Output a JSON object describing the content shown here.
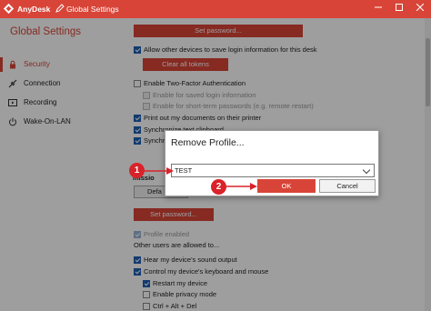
{
  "window": {
    "app_name": "AnyDesk",
    "tab_title": "Global Settings",
    "title_color": "#d84538",
    "controls": [
      "minimize",
      "maximize",
      "close"
    ]
  },
  "sidebar": {
    "heading": "Global Settings",
    "items": [
      {
        "label": "Security",
        "icon": "lock-icon",
        "active": true
      },
      {
        "label": "Connection",
        "icon": "plug-icon",
        "active": false
      },
      {
        "label": "Recording",
        "icon": "video-icon",
        "active": false
      },
      {
        "label": "Wake-On-LAN",
        "icon": "power-icon",
        "active": false
      }
    ]
  },
  "content": {
    "set_password_top": "Set password...",
    "allow_save_login": "Allow other devices to save login information for this desk",
    "clear_tokens": "Clear all tokens",
    "enable_2fa": "Enable Two-Factor Authentication",
    "enable_saved_login": "Enable for saved login information",
    "enable_short_term": "Enable for short-term passwords (e.g. remote restart)",
    "print_documents": "Print out my documents on their printer",
    "sync_clipboard": "Synchronize text clipboard",
    "sync_partial": "Synchr",
    "permissions_partial": "missio",
    "default_partial": "Defa",
    "set_password_bottom": "Set password...",
    "profile_enabled": "Profile enabled",
    "others_allowed": "Other users are allowed to...",
    "hear_sound": "Hear my device's sound output",
    "control_keyboard": "Control my device's keyboard and mouse",
    "restart_device": "Restart my device",
    "privacy_mode": "Enable privacy mode",
    "ctrl_alt_del": "Ctrl + Alt + Del"
  },
  "dialog": {
    "title": "Remove Profile...",
    "selected_profile": "TEST",
    "ok_label": "OK",
    "cancel_label": "Cancel"
  },
  "callouts": {
    "step1": "1",
    "step2": "2",
    "color": "#d8232a"
  }
}
